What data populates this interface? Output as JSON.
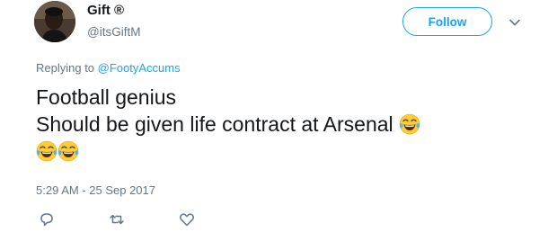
{
  "user": {
    "name": "Gift ®",
    "handle": "@itsGiftM"
  },
  "follow_button": {
    "label": "Follow",
    "color": "#1da1f2"
  },
  "more_icon": "chevron-down-icon",
  "reply_context": {
    "prefix": "Replying to ",
    "mention": "@FootyAccums"
  },
  "tweet": {
    "line1": "Football genius",
    "line2": "Should be given life contract at Arsenal",
    "emoji_name": "face-with-tears-of-joy"
  },
  "timestamp": "5:29 AM - 25 Sep 2017",
  "actions": [
    "reply-icon",
    "retweet-icon",
    "like-icon"
  ],
  "colors": {
    "text": "#14171a",
    "muted": "#657786",
    "accent": "#1da1f2"
  }
}
